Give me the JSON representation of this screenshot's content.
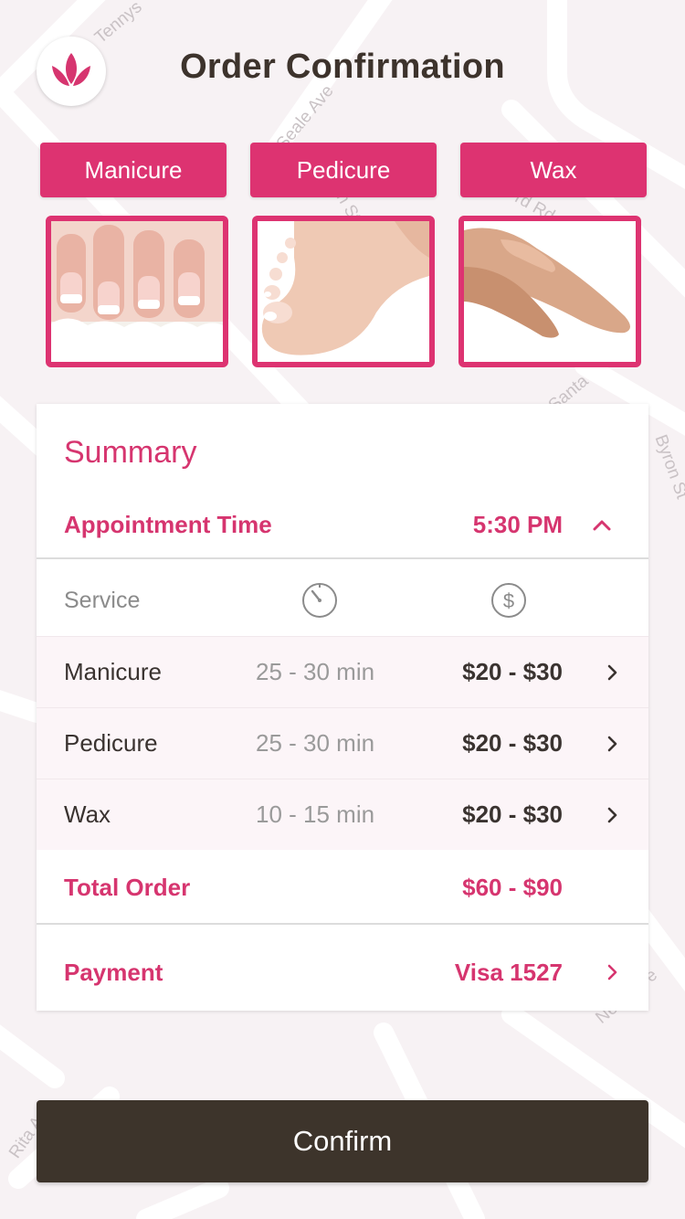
{
  "header": {
    "title": "Order Confirmation",
    "logo_icon": "lotus-icon"
  },
  "map_labels": [
    "Tennys",
    "Seale Ave",
    "n St",
    "rd Rd",
    "Santa",
    "Byron St",
    "Rita Ave",
    "Neva Ave"
  ],
  "services": [
    {
      "label": "Manicure",
      "image": "manicure-nails-image"
    },
    {
      "label": "Pedicure",
      "image": "pedicure-feet-image"
    },
    {
      "label": "Wax",
      "image": "wax-legs-image"
    }
  ],
  "summary": {
    "title": "Summary",
    "appointment_label": "Appointment Time",
    "appointment_time": "5:30 PM",
    "service_column": "Service",
    "duration_icon": "timer-icon",
    "price_icon": "dollar-circle-icon",
    "items": [
      {
        "name": "Manicure",
        "duration": "25 - 30 min",
        "price": "$20 - $30"
      },
      {
        "name": "Pedicure",
        "duration": "25 - 30 min",
        "price": "$20 - $30"
      },
      {
        "name": "Wax",
        "duration": "10 - 15 min",
        "price": "$20 - $30"
      }
    ],
    "total_label": "Total Order",
    "total_value": "$60 - $90",
    "payment_label": "Payment",
    "payment_value": "Visa 1527"
  },
  "confirm_label": "Confirm",
  "colors": {
    "accent": "#dd3371",
    "dark": "#3d342b",
    "background": "#f7f2f4"
  }
}
